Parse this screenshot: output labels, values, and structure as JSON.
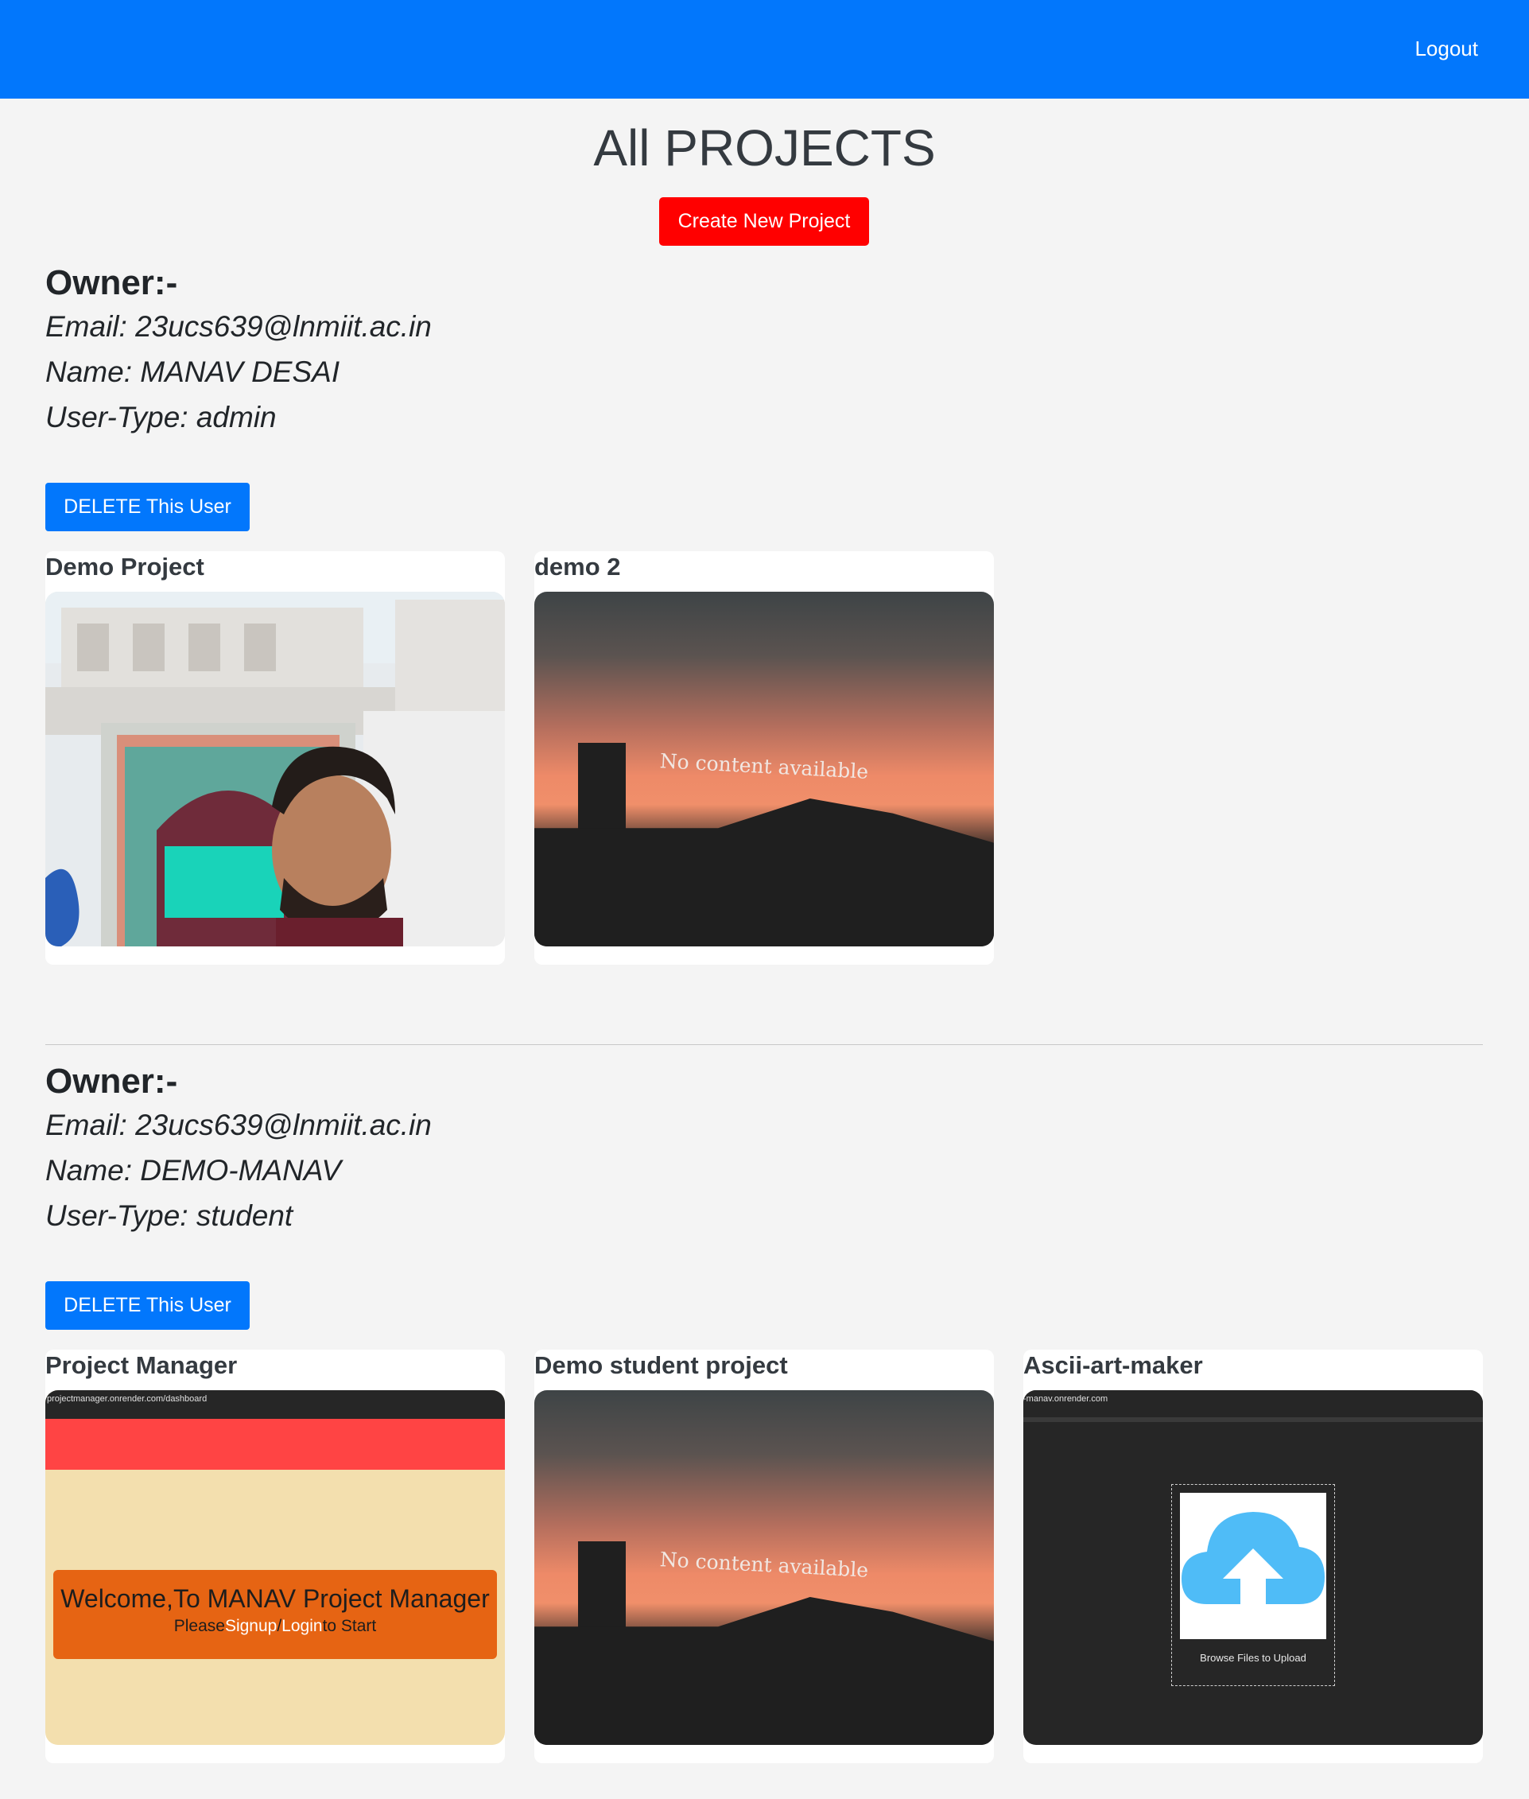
{
  "header": {
    "logout_label": "Logout"
  },
  "page": {
    "title": "All PROJECTS",
    "create_label": "Create New Project"
  },
  "owners": [
    {
      "heading": "Owner:-",
      "email": "Email: 23ucs639@lnmiit.ac.in",
      "name": "Name: MANAV DESAI",
      "user_type": "User-Type: admin",
      "delete_label": "DELETE This User",
      "projects": [
        {
          "title": "Demo Project",
          "thumb": "photo-selfie"
        },
        {
          "title": "demo 2",
          "thumb": "no-content",
          "thumb_text": "No content available"
        }
      ]
    },
    {
      "heading": "Owner:-",
      "email": "Email: 23ucs639@lnmiit.ac.in",
      "name": "Name: DEMO-MANAV",
      "user_type": "User-Type: student",
      "delete_label": "DELETE This User",
      "projects": [
        {
          "title": "Project Manager",
          "thumb": "screenshot-pm",
          "url": "projectmanager.onrender.com/dashboard",
          "welcome": "Welcome,To MANAV Project Manager",
          "please": "Please",
          "signup": "Signup",
          "slash": "/",
          "login": "Login",
          "to_start": "to Start"
        },
        {
          "title": "Demo student project",
          "thumb": "no-content",
          "thumb_text": "No content available"
        },
        {
          "title": "Ascii-art-maker",
          "thumb": "screenshot-ascii",
          "url": "-manav.onrender.com",
          "upload_label": "Browse Files to Upload"
        }
      ]
    }
  ],
  "colors": {
    "nav": "#0277fc",
    "create": "#ff0000",
    "delete": "#0277fc",
    "background": "#f4f4f4"
  }
}
